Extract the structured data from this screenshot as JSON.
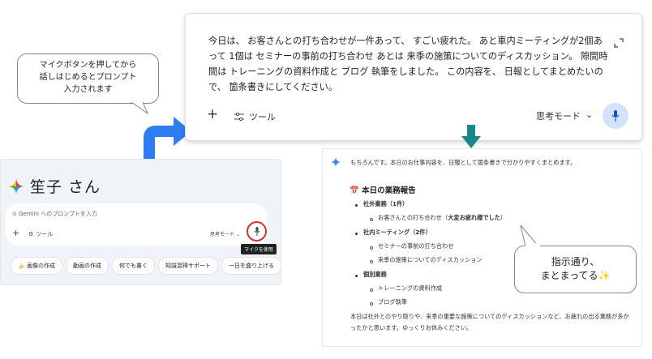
{
  "left_panel": {
    "greeting": "笙子 さん",
    "input_placeholder": "Gemini へのプロンプトを入力",
    "plus": "+",
    "tools_label": "ツール",
    "mode_label": "思考モード",
    "mic_tooltip": "マイクを使用",
    "chips": [
      "画像の作成",
      "動画の作成",
      "何でも書く",
      "知識習得サポート",
      "一日を盛り上げる"
    ],
    "chip_first_icon": "🍌"
  },
  "bubble_left": {
    "text": "マイクボタンを押してから\n話しはじめるとプロンプト\n入力されます"
  },
  "prompt_card": {
    "text": "今日は、 お客さんとの打ち合わせが一件あって、 すごい疲れた。 あと車内ミーティングが2個あ\nって 1個は セミナーの事前の打ち合わせ あとは 来季の施策についてのディスカッション。 隙間時\n間は トレーニングの資料作成と ブログ 執筆をしました。 この内容を、 日報としてまとめたいの\nで、 箇条書きにしてください。",
    "plus": "+",
    "tools_label": "ツール",
    "mode_label": "思考モード",
    "mode_chevron": "⌄"
  },
  "response": {
    "intro": "もちろんです。本日のお仕事内容を、日報として箇条書きで分かりやすくまとめます。",
    "title": "本日の業務報告",
    "title_icon": "📅",
    "sec1_label": "社外業務（1件）",
    "sec1_item_prefix": "お客さんとの打ち合わせ（",
    "sec1_item_bold": "大変お疲れ様でした",
    "sec1_item_suffix": "）",
    "sec2_label": "社内ミーティング（2件）",
    "sec2_items": [
      "セミナーの事前の打ち合わせ",
      "来季の施策についてのディスカッション"
    ],
    "sec3_label": "個別業務",
    "sec3_items": [
      "トレーニングの資料作成",
      "ブログ執筆"
    ],
    "footer": "本日は社外とのやり取りや、来季の重要な施策についてのディスカッションなど、お疲れの出る業務が多かったかと思います。ゆっくりお休みください。"
  },
  "bubble_right": {
    "text": "指示通り、\nまとまってる✨"
  },
  "colors": {
    "gemini_blue": "#4285f4",
    "arrow_blue": "#2e7df2",
    "arrow_teal": "#178a87",
    "mic_highlight_red": "#d93025",
    "mic_button_bg": "#d3e3fd"
  }
}
